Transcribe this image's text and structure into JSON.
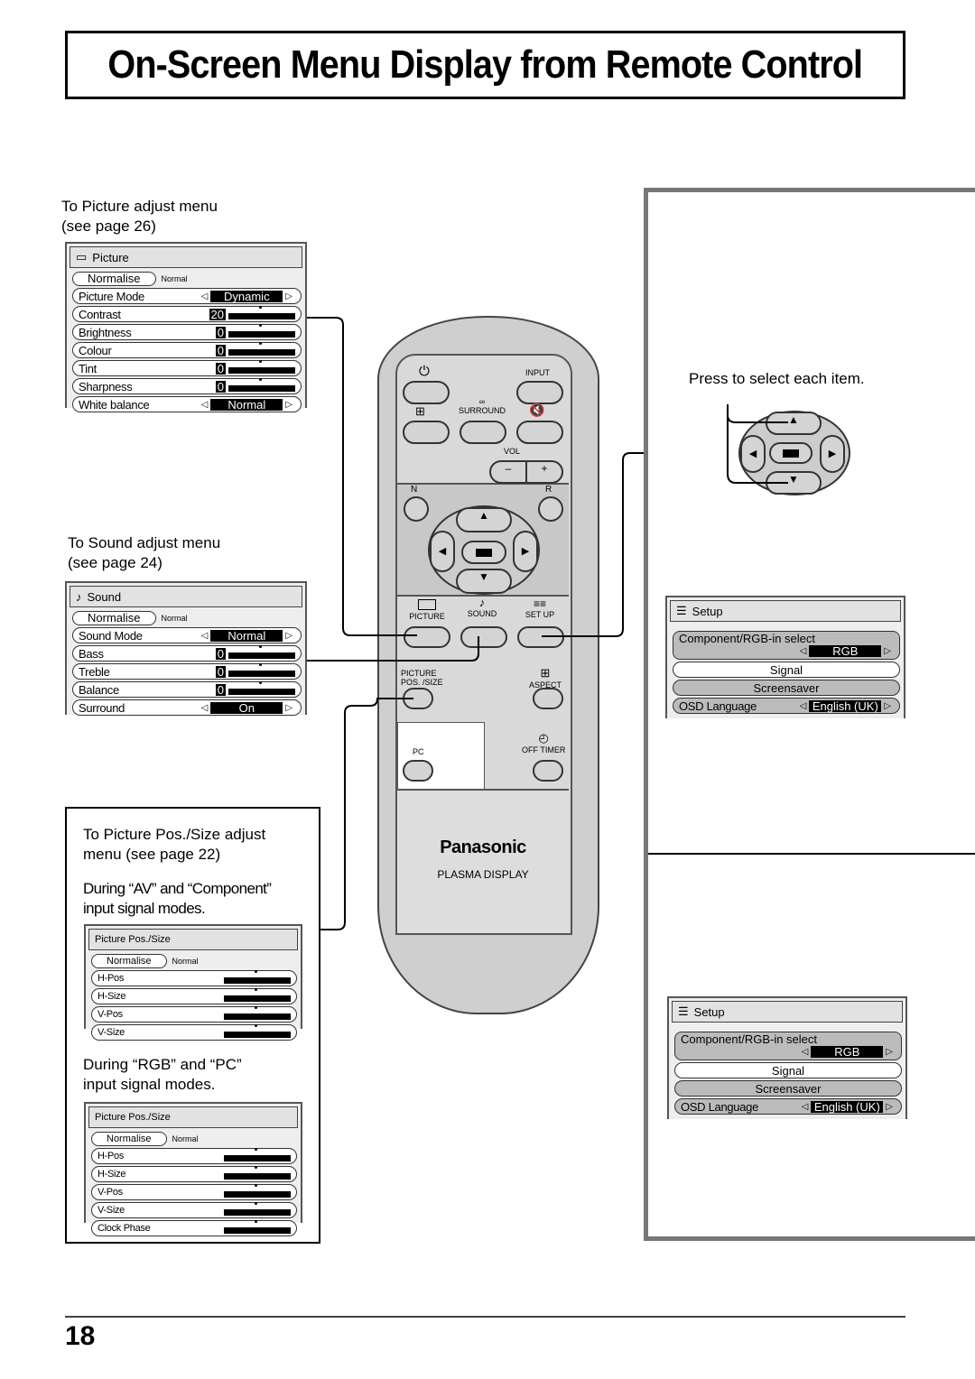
{
  "title": "On-Screen Menu Display from Remote Control",
  "page_number": "18",
  "picture_caption": {
    "line1": "To Picture adjust menu",
    "line2": " (see page 26)"
  },
  "sound_caption": {
    "line1": "To Sound adjust menu",
    "line2": "(see page 24)"
  },
  "pos_caption": {
    "line1": "To Picture Pos./Size adjust",
    "line2": "menu (see page 22)",
    "av1": "During “AV” and “Component”",
    "av2": "input signal modes.",
    "rgb1": "During “RGB” and “PC”",
    "rgb2": "input signal modes."
  },
  "press_caption": "Press to select each item.",
  "menus": {
    "picture": {
      "title": "Picture",
      "icon": "tv-icon",
      "normalise": "Normalise",
      "normal": "Normal",
      "rows": [
        {
          "label": "Picture  Mode",
          "select": "Dynamic"
        },
        {
          "label": "Contrast",
          "value": "20",
          "bar": 1
        },
        {
          "label": "Brightness",
          "value": "0",
          "bar": 1
        },
        {
          "label": "Colour",
          "value": "0",
          "bar": 1
        },
        {
          "label": "Tint",
          "value": "0",
          "bar": 1
        },
        {
          "label": "Sharpness",
          "value": "0",
          "bar": 1
        },
        {
          "label": "White balance",
          "select": "Normal"
        }
      ]
    },
    "sound": {
      "title": "Sound",
      "icon": "music-note-icon",
      "normalise": "Normalise",
      "normal": "Normal",
      "rows": [
        {
          "label": "Sound Mode",
          "select": "Normal"
        },
        {
          "label": "Bass",
          "value": "0",
          "bar": 1
        },
        {
          "label": "Treble",
          "value": "0",
          "bar": 1
        },
        {
          "label": "Balance",
          "value": "0",
          "bar": 1
        },
        {
          "label": "Surround",
          "select": "On"
        }
      ]
    },
    "pos_av": {
      "title": "Picture  Pos./Size",
      "normalise": "Normalise",
      "normal": "Normal",
      "rows": [
        {
          "label": "H-Pos",
          "bar": 1
        },
        {
          "label": "H-Size",
          "bar": 1
        },
        {
          "label": "V-Pos",
          "bar": 1
        },
        {
          "label": "V-Size",
          "bar": 1
        }
      ]
    },
    "pos_rgb": {
      "title": "Picture  Pos./Size",
      "normalise": "Normalise",
      "normal": "Normal",
      "rows": [
        {
          "label": "H-Pos",
          "bar": 1
        },
        {
          "label": "H-Size",
          "bar": 1
        },
        {
          "label": "V-Pos",
          "bar": 1
        },
        {
          "label": "V-Size",
          "bar": 1
        },
        {
          "label": "Clock  Phase",
          "bar": 1
        }
      ]
    },
    "setup": {
      "title": "Setup",
      "component_label": "Component/RGB-in select",
      "component_value": "RGB",
      "signal": "Signal",
      "screensaver": "Screensaver",
      "osd_label": "OSD  Language",
      "osd_value": "English (UK)"
    }
  },
  "remote": {
    "input": "INPUT",
    "surround": "SURROUND",
    "vol": "VOL",
    "minus": "–",
    "plus": "+",
    "n": "N",
    "r": "R",
    "picture": "PICTURE",
    "sound": "SOUND",
    "setup": "SET UP",
    "pos1": "PICTURE",
    "pos2": "POS. /SIZE",
    "aspect": "ASPECT",
    "pc": "PC",
    "off_timer": "OFF TIMER",
    "brand": "Panasonic",
    "model": "PLASMA DISPLAY"
  }
}
